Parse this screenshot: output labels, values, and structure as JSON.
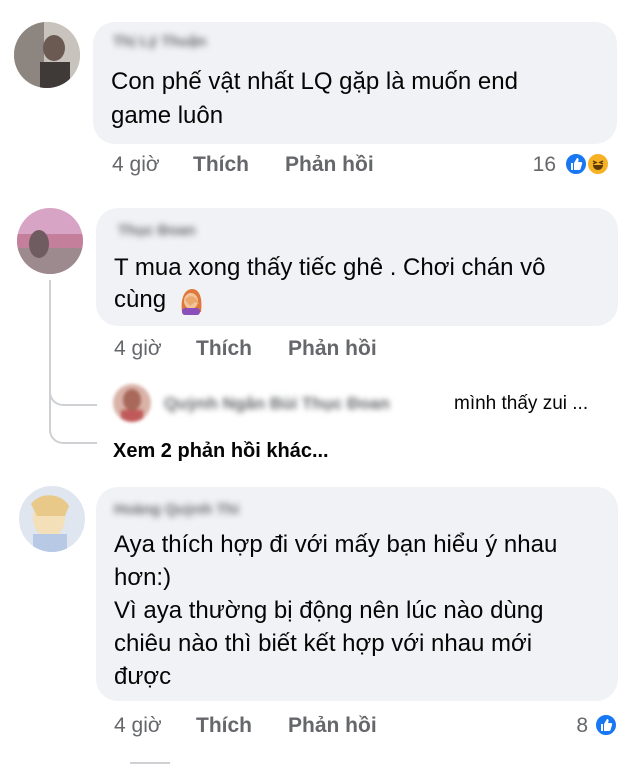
{
  "comments": [
    {
      "author": "Thị Lý Thuận",
      "text_lines": [
        "Con phế vật nhất LQ gặp là muốn end",
        "game luôn"
      ],
      "time": "4 giờ",
      "like_label": "Thích",
      "reply_label": "Phản hồi",
      "reaction_count": "16",
      "reactions": [
        "like-icon",
        "haha-icon"
      ]
    },
    {
      "author": "Thục Đoan",
      "text_lines": [
        "T mua xong thấy tiếc ghê . Chơi chán vô",
        "cùng"
      ],
      "emoji": "facepalm-emoji",
      "time": "4 giờ",
      "like_label": "Thích",
      "reply_label": "Phản hồi",
      "reply_preview": {
        "blurred_names": "Quỳnh Ngân Bùi Thục Đoan",
        "text": "mình thấy zui ..."
      },
      "more_replies": "Xem 2 phản hồi khác..."
    },
    {
      "author": "Hoàng Quỳnh Thi",
      "text_lines": [
        "Aya thích hợp đi với mấy bạn hiểu ý nhau",
        "hơn:)",
        "Vì aya thường bị động nên lúc nào dùng",
        "chiêu nào thì biết kết hợp với nhau mới",
        "được"
      ],
      "time": "4 giờ",
      "like_label": "Thích",
      "reply_label": "Phản hồi",
      "reaction_count": "8",
      "reactions": [
        "like-icon"
      ]
    }
  ],
  "colors": {
    "bubble": "#f0f2f5",
    "secondary_text": "#65676b",
    "like_blue": "#1877f2",
    "haha_yellow": "#f7b125"
  }
}
